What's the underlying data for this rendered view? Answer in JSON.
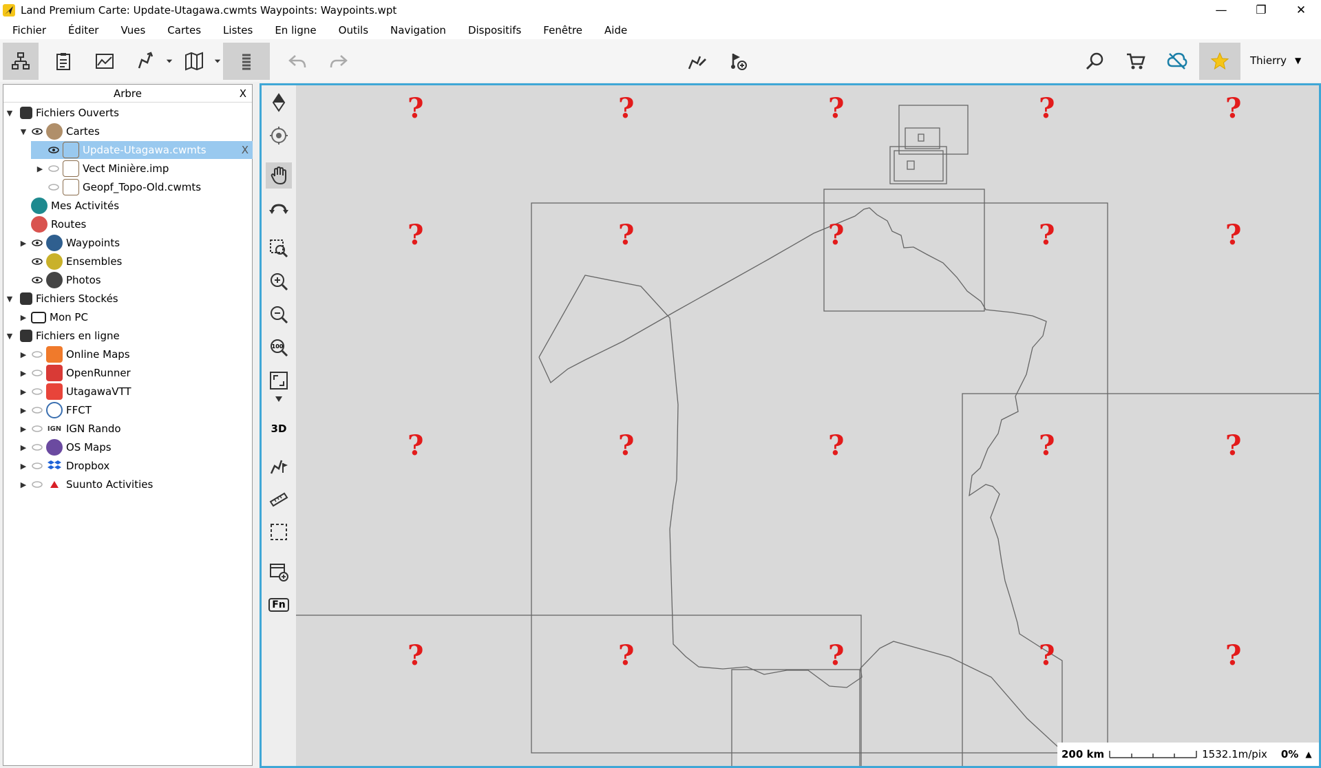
{
  "window": {
    "title": "Land Premium Carte: Update-Utagawa.cwmts Waypoints:  Waypoints.wpt",
    "minimize": "—",
    "restore": "❐",
    "close": "✕"
  },
  "menu": [
    "Fichier",
    "Éditer",
    "Vues",
    "Cartes",
    "Listes",
    "En ligne",
    "Outils",
    "Navigation",
    "Dispositifs",
    "Fenêtre",
    "Aide"
  ],
  "toolbar": {
    "user_name": "Thierry",
    "dropdown_glyph": "▼"
  },
  "tree": {
    "header": "Arbre",
    "close": "X",
    "items": [
      {
        "label": "Fichiers Ouverts"
      },
      {
        "label": "Cartes"
      },
      {
        "label": "Update-Utagawa.cwmts"
      },
      {
        "label": "Vect Minière.imp"
      },
      {
        "label": "Geopf_Topo-Old.cwmts"
      },
      {
        "label": "Mes Activités"
      },
      {
        "label": "Routes"
      },
      {
        "label": "Waypoints"
      },
      {
        "label": "Ensembles"
      },
      {
        "label": "Photos"
      },
      {
        "label": "Fichiers Stockés"
      },
      {
        "label": "Mon PC"
      },
      {
        "label": "Fichiers en ligne"
      },
      {
        "label": "Online Maps"
      },
      {
        "label": "OpenRunner"
      },
      {
        "label": "UtagawaVTT"
      },
      {
        "label": "FFCT"
      },
      {
        "label": "IGN Rando"
      },
      {
        "label": "OS Maps"
      },
      {
        "label": "Dropbox"
      },
      {
        "label": "Suunto Activities"
      }
    ],
    "ign_text": "IGN",
    "selected_close": "X"
  },
  "map": {
    "missing_tile": "?",
    "tool_3d": "3D",
    "tool_fn": "Fn",
    "tool_100": "100",
    "scale_label": "200 km",
    "resolution": "1532.1m/pix",
    "zoom": "0%",
    "scale_arrow": "▲"
  },
  "colors": {
    "accent": "#3fa7d6",
    "selected_row": "#99c9ef",
    "missing_tile": "#e31b1b"
  }
}
